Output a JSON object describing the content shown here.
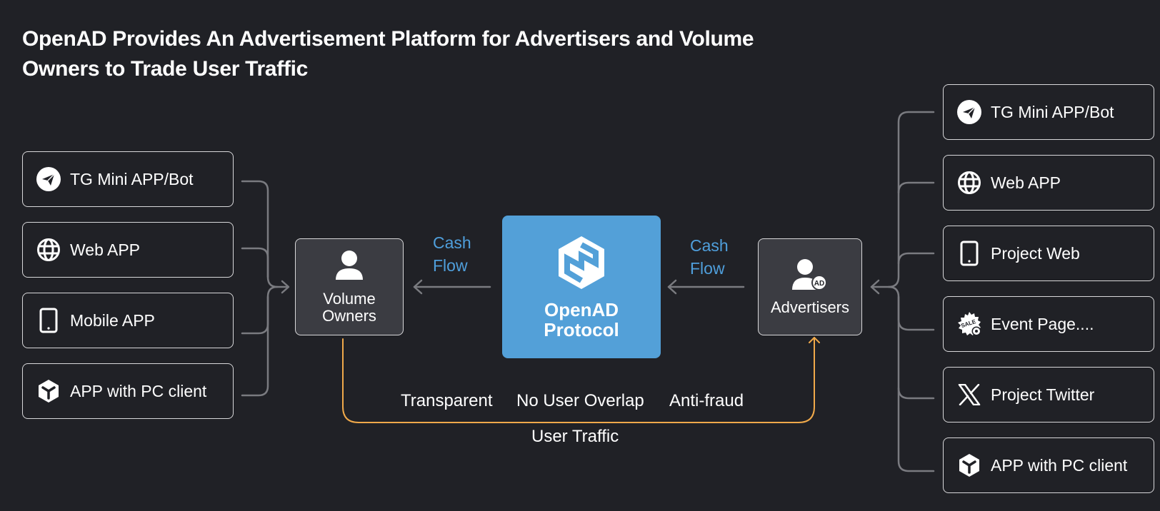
{
  "title": "OpenAD Provides An Advertisement Platform for Advertisers and Volume Owners to Trade User Traffic",
  "left_sources": [
    {
      "label": "TG Mini APP/Bot",
      "icon": "telegram-icon"
    },
    {
      "label": "Web APP",
      "icon": "globe-icon"
    },
    {
      "label": "Mobile APP",
      "icon": "mobile-icon"
    },
    {
      "label": "APP with PC client",
      "icon": "cube-icon"
    }
  ],
  "right_sources": [
    {
      "label": "TG Mini APP/Bot",
      "icon": "telegram-icon"
    },
    {
      "label": "Web APP",
      "icon": "globe-icon"
    },
    {
      "label": "Project Web",
      "icon": "mobile-icon"
    },
    {
      "label": "Event Page....",
      "icon": "sale-badge-icon"
    },
    {
      "label": "Project Twitter",
      "icon": "x-logo-icon"
    },
    {
      "label": "APP with PC client",
      "icon": "cube-icon"
    }
  ],
  "volume_owners": {
    "line1": "Volume",
    "line2": "Owners",
    "icon": "user-icon"
  },
  "advertisers": {
    "label": "Advertisers",
    "icon": "user-ad-icon"
  },
  "protocol": {
    "line1": "OpenAD",
    "line2": "Protocol",
    "icon": "openad-logo-icon"
  },
  "cash_flow_left": {
    "line1": "Cash",
    "line2": "Flow"
  },
  "cash_flow_right": {
    "line1": "Cash",
    "line2": "Flow"
  },
  "features": [
    "Transparent",
    "No User Overlap",
    "Anti-fraud"
  ],
  "user_traffic_label": "User Traffic",
  "colors": {
    "background": "#202126",
    "protocol_blue": "#53a0d8",
    "cash_flow_text": "#4f9fdc",
    "user_traffic_line": "#f0a94a",
    "connector_gray": "#7a7b80",
    "node_fill": "#3b3c42"
  }
}
